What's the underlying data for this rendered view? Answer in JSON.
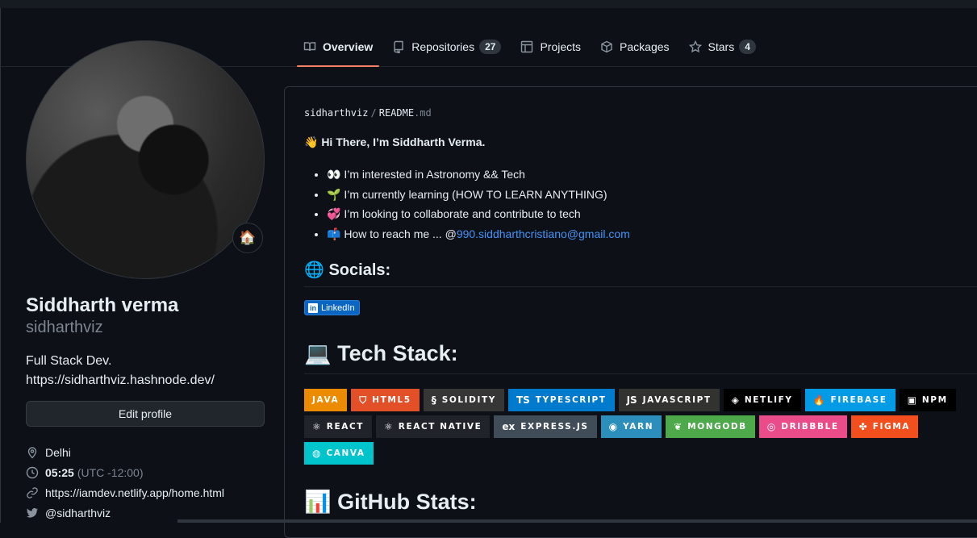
{
  "tabs": [
    {
      "label": "Overview",
      "icon": "book-icon",
      "active": true
    },
    {
      "label": "Repositories",
      "icon": "repo-icon",
      "count": "27"
    },
    {
      "label": "Projects",
      "icon": "table-icon"
    },
    {
      "label": "Packages",
      "icon": "package-icon"
    },
    {
      "label": "Stars",
      "icon": "star-icon",
      "count": "4"
    }
  ],
  "profile": {
    "name": "Siddharth verma",
    "login": "sidharthviz",
    "status_emoji": "🏠",
    "bio_line1": "Full Stack Dev.",
    "bio_line2": "https://sidharthviz.hashnode.dev/",
    "edit_label": "Edit profile",
    "location": "Delhi",
    "time": "05:25",
    "timezone": "(UTC -12:00)",
    "website": "https://iamdev.netlify.app/home.html",
    "twitter": "@sidharthviz"
  },
  "readme": {
    "owner": "sidharthviz",
    "sep": "/",
    "file": "README",
    "ext": ".md",
    "greeting": "👋 Hi There, I’m Siddharth Verma.",
    "points": [
      "👀 I’m interested in Astronomy && Tech",
      "🌱 I’m currently learning (HOW TO LEARN ANYTHING)",
      "💞️ I’m looking to collaborate and contribute to tech"
    ],
    "reach_prefix": "📫 How to reach me ... @",
    "reach_email": "990.siddharthcristiano@gmail.com",
    "socials_heading": "🌐 Socials:",
    "linkedin_label": "LinkedIn",
    "tech_heading": "💻 Tech Stack:",
    "stats_heading": "📊 GitHub Stats:"
  },
  "badges": [
    {
      "label": "JAVA",
      "icon": "",
      "color": "#ED8B00"
    },
    {
      "label": "HTML5",
      "icon": "⛉",
      "color": "#E34F26"
    },
    {
      "label": "SOLIDITY",
      "icon": "§",
      "color": "#363636"
    },
    {
      "label": "TYPESCRIPT",
      "icon": "TS",
      "color": "#007ACC"
    },
    {
      "label": "JAVASCRIPT",
      "icon": "JS",
      "color": "#323330"
    },
    {
      "label": "NETLIFY",
      "icon": "◈",
      "color": "#000000"
    },
    {
      "label": "FIREBASE",
      "icon": "🔥",
      "color": "#039BE5"
    },
    {
      "label": "NPM",
      "icon": "▣",
      "color": "#000000"
    },
    {
      "label": "REACT",
      "icon": "⚛",
      "color": "#20232A"
    },
    {
      "label": "REACT NATIVE",
      "icon": "⚛",
      "color": "#20232A"
    },
    {
      "label": "EXPRESS.JS",
      "icon": "ex",
      "color": "#404D59"
    },
    {
      "label": "YARN",
      "icon": "◉",
      "color": "#2C8EBB"
    },
    {
      "label": "MONGODB",
      "icon": "❦",
      "color": "#4EA94B"
    },
    {
      "label": "DRIBBBLE",
      "icon": "◎",
      "color": "#EA4C89"
    },
    {
      "label": "FIGMA",
      "icon": "✤",
      "color": "#F24E1E"
    },
    {
      "label": "CANVA",
      "icon": "◍",
      "color": "#00C4CC"
    }
  ],
  "colors": {
    "background": "#0d1117",
    "accent_underline": "#f78166",
    "link": "#4493f8",
    "linkedin": "#0a66c2"
  }
}
